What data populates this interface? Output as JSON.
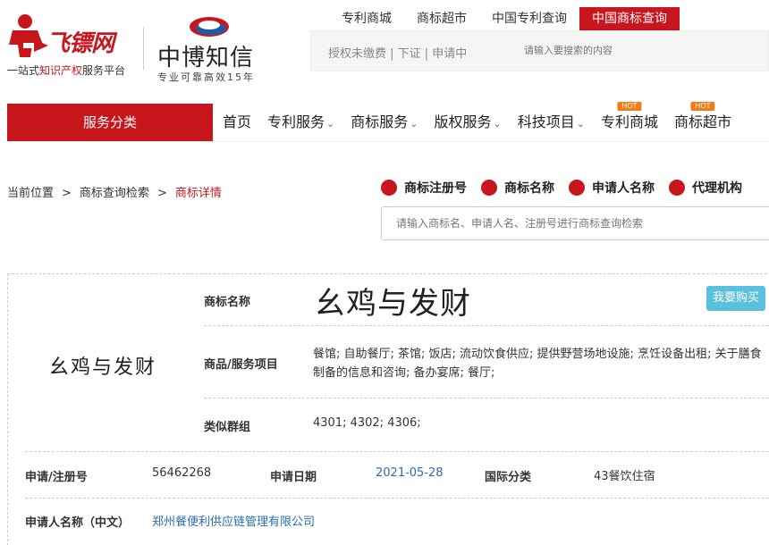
{
  "brand1": {
    "name": "飞镖网",
    "slogan_pre": "一站式",
    "slogan_hl": "知识产权",
    "slogan_post": "服务平台"
  },
  "brand2": {
    "name": "中博知信",
    "slogan": "专业可靠高效15年"
  },
  "top_links": [
    {
      "label": "专利商城"
    },
    {
      "label": "商标超市"
    },
    {
      "label": "中国专利查询"
    },
    {
      "label": "中国商标查询"
    }
  ],
  "top_bar": {
    "status": "授权未缴费 | 下证 | 申请中",
    "search_placeholder": "请输入要搜索的内容"
  },
  "category_button": "服务分类",
  "nav": [
    {
      "label": "首页",
      "chevron": false,
      "hot": ""
    },
    {
      "label": "专利服务",
      "chevron": true,
      "hot": ""
    },
    {
      "label": "商标服务",
      "chevron": true,
      "hot": ""
    },
    {
      "label": "版权服务",
      "chevron": true,
      "hot": ""
    },
    {
      "label": "科技项目",
      "chevron": true,
      "hot": ""
    },
    {
      "label": "专利商城",
      "chevron": false,
      "hot": "HOT"
    },
    {
      "label": "商标超市",
      "chevron": false,
      "hot": "HOT"
    }
  ],
  "breadcrumb": {
    "items": [
      "当前位置",
      "商标查询检索",
      "商标详情"
    ],
    "sep": ">"
  },
  "search_types": [
    "商标注册号",
    "商标名称",
    "申请人名称",
    "代理机构"
  ],
  "main_search_placeholder": "请输入商标名、申请人名、注册号进行商标查询检索",
  "detail": {
    "thumbnail_text": "幺鸡与发财",
    "name_label": "商标名称",
    "name": "幺鸡与发财",
    "buy_button": "我要购买",
    "goods_label": "商品/服务项目",
    "goods": "餐馆; 自助餐厅; 茶馆; 饭店; 流动饮食供应; 提供野营场地设施; 烹饪设备出租; 关于膳食制备的信息和咨询; 备办宴席; 餐厅;",
    "group_label": "类似群组",
    "group": "4301; 4302; 4306;",
    "reg_no_label": "申请/注册号",
    "reg_no": "56462268",
    "date_label": "申请日期",
    "date": "2021-05-28",
    "class_label": "国际分类",
    "class": "43餐饮住宿",
    "applicant_label": "申请人名称（中文）",
    "applicant": "郑州餐便利供应链管理有限公司"
  },
  "colors": {
    "brand_red": "#c8161d",
    "buy_button": "#5bc0de",
    "link_blue": "#2a6db3",
    "hot_badge": "#f07b1b"
  }
}
